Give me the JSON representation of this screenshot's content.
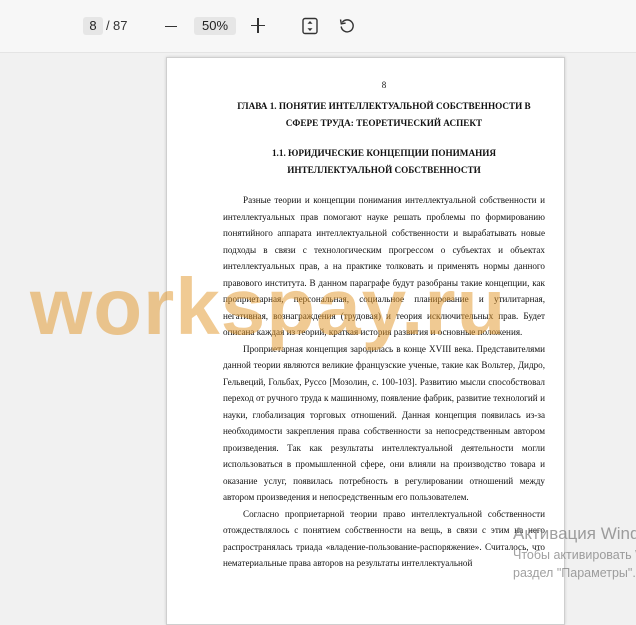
{
  "toolbar": {
    "current_page": "8",
    "page_separator": "/",
    "total_pages": "87",
    "zoom": "50%",
    "icons": [
      "minus-icon",
      "plus-icon",
      "fit-page-icon",
      "rotate-icon"
    ]
  },
  "document": {
    "page_number": "8",
    "chapter_title": "ГЛАВА 1. ПОНЯТИЕ ИНТЕЛЛЕКТУАЛЬНОЙ СОБСТВЕННОСТИ В СФЕРЕ ТРУДА: ТЕОРЕТИЧЕСКИЙ АСПЕКТ",
    "section_title": "1.1. ЮРИДИЧЕСКИЕ КОНЦЕПЦИИ ПОНИМАНИЯ ИНТЕЛЛЕКТУАЛЬНОЙ СОБСТВЕННОСТИ",
    "paragraphs": [
      "Разные теории и концепции понимания интеллектуальной собственности и интеллектуальных прав помогают науке решать проблемы по формированию понятийного аппарата интеллектуальной собственности и вырабатывать новые подходы в связи с технологическим прогрессом о субъектах и объектах интеллектуальных прав, а на практике толковать и применять нормы данного правового института. В данном параграфе будут разобраны такие концепции, как проприетарная, персональная, социальное планирование и утилитарная, негативная, вознаграждения (трудовая) и теория исключительных прав. Будет описана каждая из теорий, краткая история развития и основные положения.",
      "Проприетарная концепция зародилась в конце XVIII века. Представителями данной теории являются великие французские ученые, такие как Вольтер, Дидро, Гельвеций, Гольбах, Руссо [Мозолин, с. 100-103]. Развитию мысли способствовал переход от ручного труда к машинному, появление фабрик, развитие технологий и науки, глобализация торговых отношений. Данная концепция появилась из-за необходимости закрепления права собственности за непосредственным автором произведения. Так как результаты интеллектуальной деятельности могли использоваться в промышленной сфере, они влияли на производство товара и оказание услуг, появилась потребность в регулировании отношений между автором произведения и непосредственным его пользователем.",
      "Согласно проприетарной теории право интеллектуальной собственности отождествлялось с понятием собственности на вещь, в связи с этим на него распространялась триада «владение-пользование-распоряжение». Считалось, что нематериальные права авторов на результаты интеллектуальной"
    ]
  },
  "watermark": "workspay.ru",
  "os_notice": {
    "title": "Активация Windows",
    "line1": "Чтобы активировать Windows, перейдите в",
    "line2": "раздел \"Параметры\"."
  }
}
